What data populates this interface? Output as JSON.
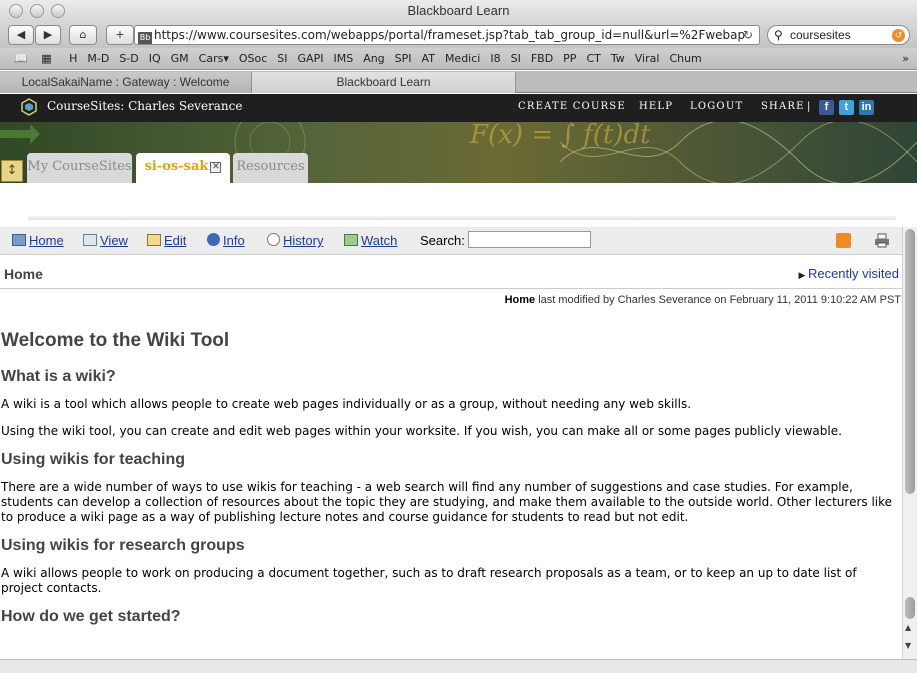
{
  "browser": {
    "window_title": "Blackboard Learn",
    "url": "https://www.coursesites.com/webapps/portal/frameset.jsp?tab_tab_group_id=null&url=%2Fwebap",
    "search_value": "coursesites",
    "bookmarks": [
      "H",
      "M-D",
      "S-D",
      "IQ",
      "GM",
      "Cars▾",
      "OSoc",
      "SI",
      "GAPI",
      "IMS",
      "Ang",
      "SPI",
      "AT",
      "Medici",
      "I8",
      "SI",
      "FBD",
      "PP",
      "CT",
      "Tw",
      "Viral",
      "Chum"
    ],
    "tabs": [
      {
        "label": "LocalSakaiName : Gateway : Welcome",
        "active": false
      },
      {
        "label": "Blackboard Learn",
        "active": true
      }
    ]
  },
  "bb": {
    "site_title": "CourseSites: Charles Severance",
    "menu": [
      "CREATE COURSE",
      "HELP",
      "LOGOUT",
      "SHARE"
    ],
    "separator": "|",
    "course_tabs": [
      {
        "label": "My CourseSites",
        "active": false
      },
      {
        "label": "si-os-sak",
        "active": true
      },
      {
        "label": "Resources",
        "active": false
      }
    ],
    "banner_formula": "F(x) = ∫ f(t)dt"
  },
  "wiki": {
    "toolbar": {
      "home": "Home",
      "view": "View",
      "edit": "Edit",
      "info": "Info",
      "history": "History",
      "watch": "Watch",
      "search_label": "Search:"
    },
    "breadcrumb": "Home",
    "recently_visited": "Recently visited",
    "modified": {
      "page": "Home",
      "text": "last modified by Charles Severance on February 11, 2011 9:10:22 AM PST"
    },
    "title": "Welcome to the Wiki Tool",
    "sections": [
      {
        "heading": "What is a wiki?",
        "paragraphs": [
          "A wiki is a tool which allows people to create web pages individually or as a group, without needing any web skills.",
          "Using the wiki tool, you can create and edit web pages within your worksite. If you wish, you can make all or some pages publicly viewable."
        ]
      },
      {
        "heading": "Using wikis for teaching",
        "paragraphs": [
          "There are a wide number of ways to use wikis for teaching - a web search will find any number of suggestions and case studies. For example, students can develop a collection of resources about the topic they are studying, and make them available to the outside world. Other lecturers like to produce a wiki page as a way of publishing lecture notes and course guidance for students to read but not edit."
        ]
      },
      {
        "heading": "Using wikis for research groups",
        "paragraphs": [
          "A wiki allows people to work on producing a document together, such as to draft research proposals as a team, or to keep an up to date list of project contacts."
        ]
      },
      {
        "heading": "How do we get started?",
        "paragraphs": []
      }
    ]
  },
  "colors": {
    "link": "#1a3b9a",
    "active_course_tab": "#e2a400",
    "header_bg": "#1f1f1f"
  }
}
